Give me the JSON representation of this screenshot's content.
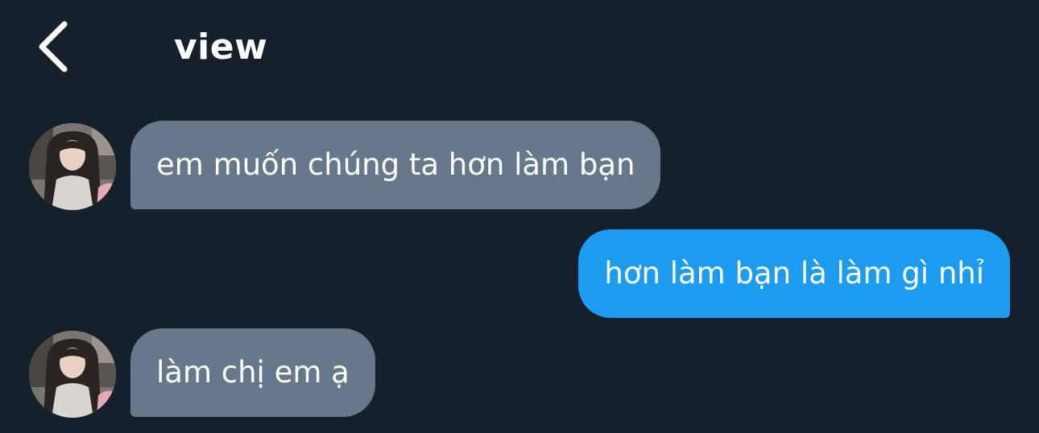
{
  "header": {
    "back_icon": "chevron-left-icon",
    "title": "view"
  },
  "messages": [
    {
      "direction": "incoming",
      "text": "em muốn chúng ta hơn làm bạn",
      "avatar_icon": "avatar-photo-icon"
    },
    {
      "direction": "outgoing",
      "text": "hơn làm bạn là làm gì nhỉ"
    },
    {
      "direction": "incoming",
      "text": "làm chị em ạ",
      "avatar_icon": "avatar-photo-icon"
    }
  ],
  "colors": {
    "background": "#16202b",
    "incoming_bubble": "#66788a",
    "outgoing_bubble": "#1d9bf0",
    "text": "#ffffff"
  }
}
